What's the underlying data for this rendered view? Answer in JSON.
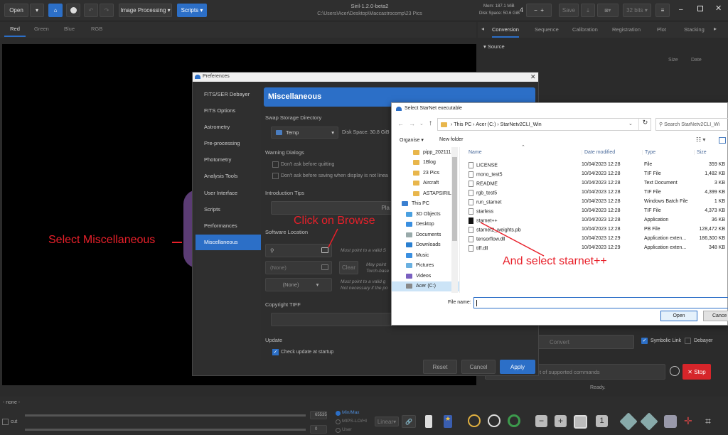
{
  "colors": {
    "accent": "#2c6fc7",
    "annotation": "#e8202a",
    "stop": "#d6252a"
  },
  "toolbar": {
    "open": "Open",
    "image_processing": "Image Processing",
    "scripts": "Scripts",
    "save": "Save",
    "bits": "32 bits"
  },
  "app": {
    "title": "Siril-1.2.0-beta2",
    "path": "C:\\Users\\Acer\\Desktop\\Maccastrocomp\\23 Pics",
    "mem": "Mem: 187.1 MiB",
    "disk": "Disk Space: 50.6 GiB",
    "threads": "4"
  },
  "channels": [
    "Red",
    "Green",
    "Blue",
    "RGB"
  ],
  "right_tabs": [
    "Conversion",
    "Sequence",
    "Calibration",
    "Registration",
    "Plot",
    "Stacking"
  ],
  "conversion": {
    "source": "Source",
    "col_size": "Size",
    "col_date": "Date",
    "convert": "Convert",
    "symbolic": "Symbolic Link",
    "debayer": "Debayer",
    "commands": "t of supported commands",
    "stop": "Stop",
    "ready": "Ready."
  },
  "bottom": {
    "none": "- none -",
    "cut": "cut",
    "max": "65535",
    "min": "0",
    "minmax": "Min/Max",
    "mips": "MIPS-LO/HI",
    "user": "User",
    "linear": "Linear",
    "zoom": "1"
  },
  "prefs": {
    "title": "Preferences",
    "sidebar": [
      "FITS/SER Debayer",
      "FITS Options",
      "Astrometry",
      "Pre-processing",
      "Photometry",
      "Analysis Tools",
      "User Interface",
      "Scripts",
      "Performances",
      "Miscellaneous"
    ],
    "header": "Miscellaneous",
    "swap_title": "Swap Storage Directory",
    "swap_value": "Temp",
    "disk_space": "Disk Space: 30.8 GiB",
    "warn_title": "Warning Dialogs",
    "warn_1": "Don't ask before quitting",
    "warn_2": "Don't ask before saving when display is not linea",
    "intro_title": "Introduction Tips",
    "intro_play": "Pla",
    "software_title": "Software Location",
    "must_point": "Must point to a valid S",
    "none1": "(None)",
    "clear": "Clear",
    "may_point": "May point",
    "torch": "Torch-base",
    "none2": "(None)",
    "must_point2": "Must point to a valid g",
    "not_necessary": "Not necessary if the po",
    "copyright": "Copyright TIFF",
    "update_title": "Update",
    "check_update": "Check update at startup",
    "reset": "Reset",
    "cancel": "Cancel",
    "apply": "Apply"
  },
  "dialog": {
    "title": "Select StarNet executable",
    "breadcrumb": [
      "This PC",
      "Acer (C:)",
      "StarNetv2CLI_Win"
    ],
    "search_placeholder": "Search StarNetv2CLI_Wi",
    "organise": "Organise",
    "new_folder": "New folder",
    "nav": [
      "pipp_2021112",
      "1Blog",
      "23 Pics",
      "Aircraft",
      "ASTAPSIRIL",
      "This PC",
      "3D Objects",
      "Desktop",
      "Documents",
      "Downloads",
      "Music",
      "Pictures",
      "Videos",
      "Acer (C:)"
    ],
    "columns": [
      "Name",
      "Date modified",
      "Type",
      "Size"
    ],
    "rows": [
      {
        "name": "LICENSE",
        "date": "10/04/2023 12:28",
        "type": "File",
        "size": "359 KB"
      },
      {
        "name": "mono_test5",
        "date": "10/04/2023 12:28",
        "type": "TIF File",
        "size": "1,482 KB"
      },
      {
        "name": "README",
        "date": "10/04/2023 12:28",
        "type": "Text Document",
        "size": "3 KB"
      },
      {
        "name": "rgb_test5",
        "date": "10/04/2023 12:28",
        "type": "TIF File",
        "size": "4,399 KB"
      },
      {
        "name": "run_starnet",
        "date": "10/04/2023 12:28",
        "type": "Windows Batch File",
        "size": "1 KB"
      },
      {
        "name": "starless",
        "date": "10/04/2023 12:28",
        "type": "TIF File",
        "size": "4,373 KB"
      },
      {
        "name": "starnet++",
        "date": "10/04/2023 12:28",
        "type": "Application",
        "size": "36 KB"
      },
      {
        "name": "starnet2_weights.pb",
        "date": "10/04/2023 12:28",
        "type": "PB File",
        "size": "128,472 KB"
      },
      {
        "name": "tensorflow.dll",
        "date": "10/04/2023 12:29",
        "type": "Application exten...",
        "size": "186,300 KB"
      },
      {
        "name": "tiff.dll",
        "date": "10/04/2023 12:29",
        "type": "Application exten...",
        "size": "348 KB"
      }
    ],
    "filename_label": "File name:",
    "open": "Open",
    "cancel": "Cance"
  },
  "annotations": {
    "select_misc": "Select Miscellaneous",
    "browse": "Click on Browse",
    "select_starnet": "And select starnet++"
  }
}
